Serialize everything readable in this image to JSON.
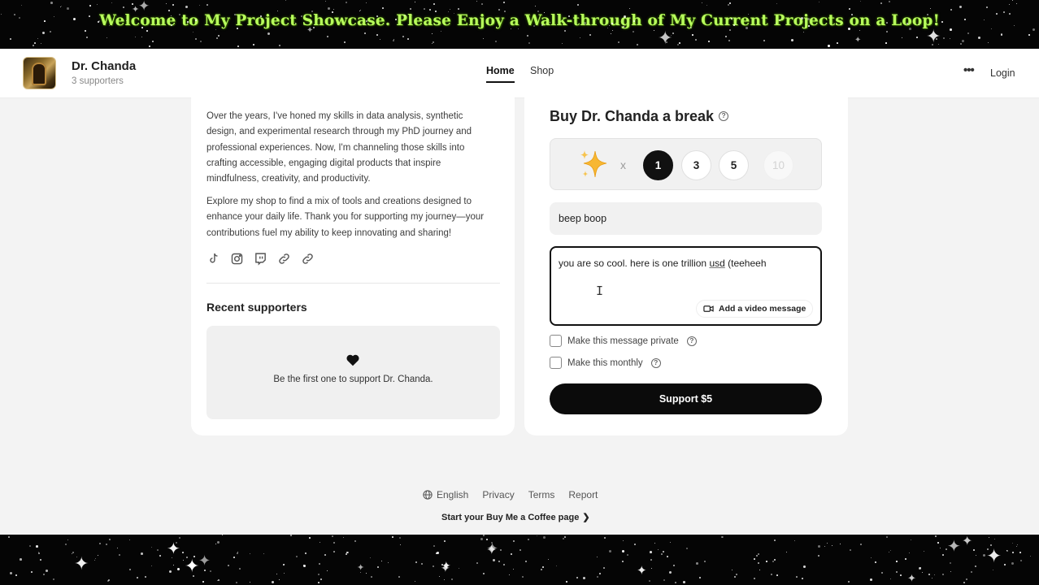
{
  "banner": {
    "text": "Welcome to My Project Showcase. Please Enjoy a Walk-through of My Current Projects on a Loop!"
  },
  "header": {
    "creator_name": "Dr. Chanda",
    "supporters": "3 supporters",
    "nav": [
      "Home",
      "Shop"
    ],
    "active_tab": "Home",
    "more_label": "•••",
    "login": "Login"
  },
  "about": {
    "paragraphs": [
      "Over the years, I've honed my skills in data analysis, synthetic design, and experimental research through my PhD journey and professional experiences. Now, I'm channeling those skills into crafting accessible, engaging digital products that inspire mindfulness, creativity, and productivity.",
      "Explore my shop to find a mix of tools and creations designed to enhance your daily life. Thank you for supporting my journey—your contributions fuel my ability to keep innovating and sharing!"
    ],
    "social_icons": [
      "tiktok-icon",
      "instagram-icon",
      "twitch-icon",
      "link-icon",
      "link-icon"
    ]
  },
  "recent_supporters": {
    "title": "Recent supporters",
    "empty_text": "Be the first one to support Dr. Chanda."
  },
  "support_panel": {
    "title": "Buy Dr. Chanda a break",
    "multiplier": "x",
    "quantities": [
      "1",
      "3",
      "5",
      "10"
    ],
    "selected_quantity": "1",
    "name_value": "beep boop",
    "message_value_pre": "you are so cool. here is one trillion ",
    "message_value_underlined": "usd",
    "message_value_post": " (teeheeh",
    "video_button": "Add a video message",
    "private_label": "Make this message private",
    "monthly_label": "Make this monthly",
    "support_button": "Support $5"
  },
  "footer": {
    "language": "English",
    "links": [
      "Privacy",
      "Terms",
      "Report"
    ],
    "start_page": "Start your Buy Me a Coffee page"
  },
  "colors": {
    "banner_text": "#b8ff5c",
    "primary_button": "#0b0b0b",
    "page_bg": "#f3f3f3"
  }
}
